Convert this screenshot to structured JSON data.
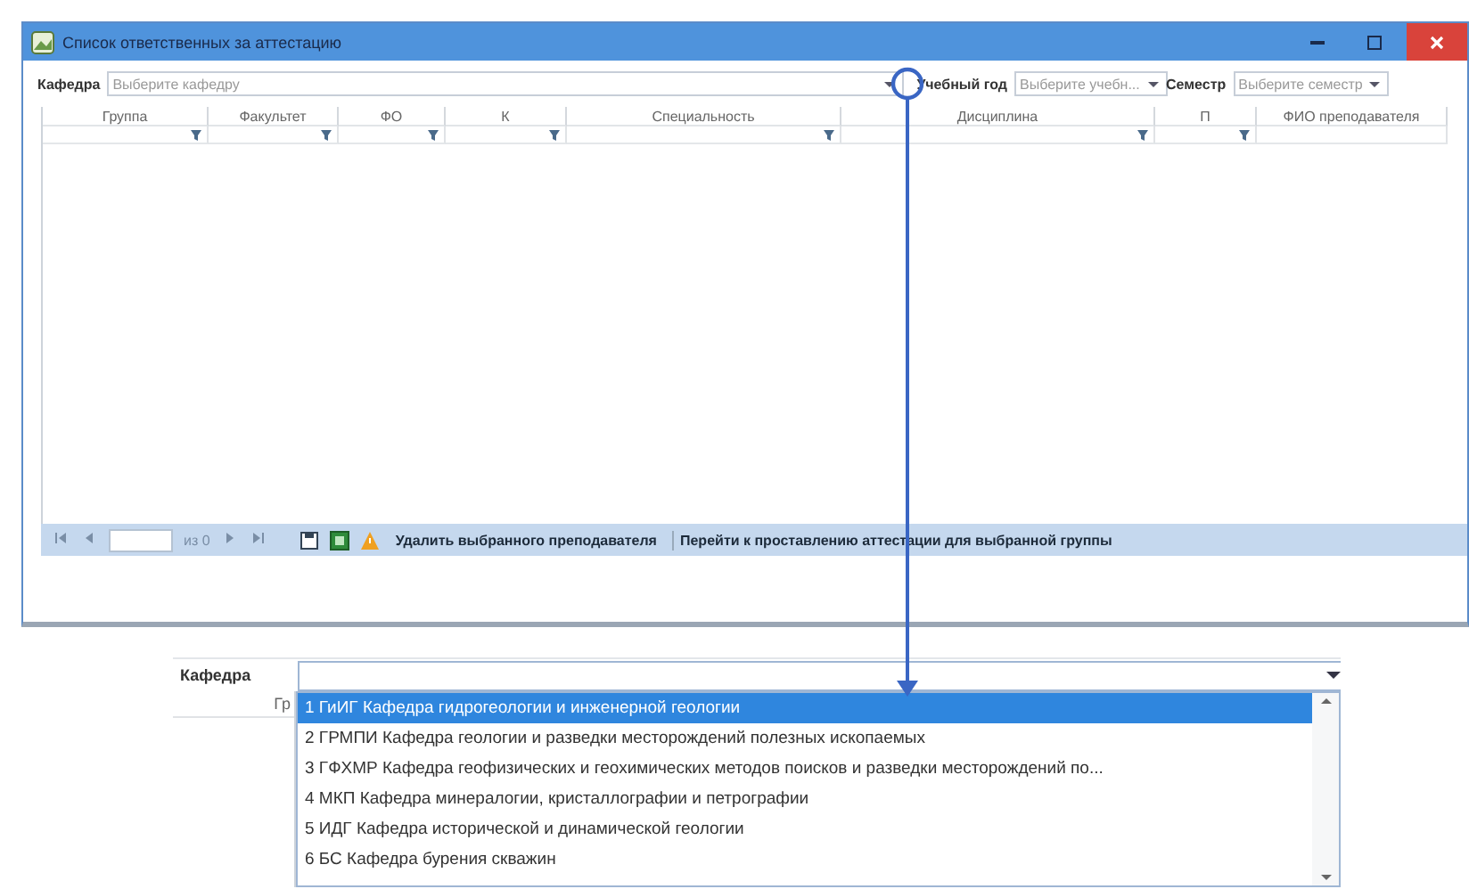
{
  "window": {
    "title": "Список ответственных за аттестацию"
  },
  "filters": [
    {
      "kind": "wide",
      "label": "Кафедра",
      "placeholder": "Выберите кафедру"
    },
    {
      "kind": "narrow",
      "label": "Учебный год",
      "placeholder": "Выберите учебн..."
    },
    {
      "kind": "narrow",
      "label": "Семестр",
      "placeholder": "Выберите семестр"
    }
  ],
  "table": {
    "columns": [
      {
        "label": "Группа",
        "filterable": true
      },
      {
        "label": "Факультет",
        "filterable": true
      },
      {
        "label": "ФО",
        "filterable": true
      },
      {
        "label": "К",
        "filterable": true
      },
      {
        "label": "Специальность",
        "filterable": true
      },
      {
        "label": "Дисциплина",
        "filterable": true
      },
      {
        "label": "П",
        "filterable": true
      },
      {
        "label": "ФИО преподавателя",
        "filterable": false
      }
    ]
  },
  "pager": {
    "page_count": "из 0"
  },
  "actions": [
    {
      "label": "Удалить выбранного преподавателя"
    },
    {
      "label": "Перейти к проставлению аттестации для выбранной группы"
    }
  ],
  "dropdown": {
    "label": "Кафедра",
    "header_fragment": "Гр",
    "items": [
      {
        "text": "1 ГиИГ Кафедра гидрогеологии и инженерной геологии",
        "selected": true
      },
      {
        "text": "2 ГРМПИ Кафедра геологии и разведки месторождений полезных ископаемых",
        "selected": false
      },
      {
        "text": "3 ГФХМР Кафедра геофизических и геохимических методов поисков и разведки месторождений по...",
        "selected": false
      },
      {
        "text": "4 МКП Кафедра минералогии, кристаллографии и петрографии",
        "selected": false
      },
      {
        "text": "5 ИДГ Кафедра исторической и динамической геологии",
        "selected": false
      },
      {
        "text": "6 БС Кафедра бурения скважин",
        "selected": false
      }
    ]
  }
}
